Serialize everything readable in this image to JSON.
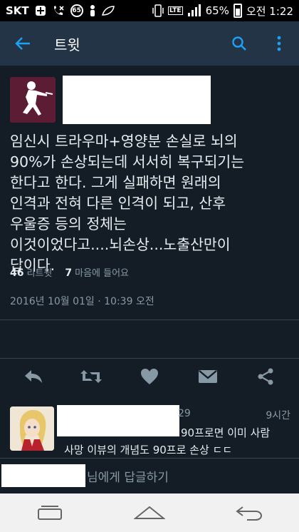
{
  "status_bar": {
    "carrier": "SKT",
    "notification_badge": "65",
    "network": "LTE",
    "battery": "65%",
    "time": "오전 1:22"
  },
  "app_bar": {
    "title": "트윗"
  },
  "tweet": {
    "text": "임신시 트라우마+영양분 손실로 뇌의\n90%가 손상되는데 서서히 복구되기는\n한다고 한다. 그게 실패하면 원래의\n인격과 전혀 다른 인격이 되고, 산후\n우울증 등의 정체는\n이것이었다고....뇌손상...노출산만이\n답이다.",
    "timestamp": "2016년 10월 01일 · 10:39 오전",
    "retweets_count": "46",
    "retweets_label": "리트윗",
    "likes_count": "7",
    "likes_label": "마음에 들어요"
  },
  "reply": {
    "count_fragment": "29",
    "time": "9시간",
    "line1": "90프로면 이미 사람",
    "line2": "사망 이뷰의 개념도 90프로 손상 ㄷㄷ"
  },
  "compose": {
    "suffix_text": "님에게 답글하기"
  },
  "colors": {
    "background": "#141d26",
    "app_bar": "#243447",
    "accent": "#1da1f2",
    "muted": "#8899a6"
  }
}
